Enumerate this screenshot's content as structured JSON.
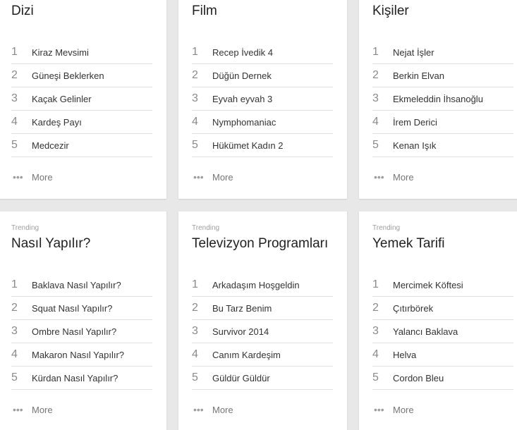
{
  "cards": [
    {
      "label": "",
      "title": "Dizi",
      "items": [
        {
          "rank": "1",
          "name": "Kiraz Mevsimi"
        },
        {
          "rank": "2",
          "name": "Güneşi Beklerken"
        },
        {
          "rank": "3",
          "name": "Kaçak Gelinler"
        },
        {
          "rank": "4",
          "name": "Kardeş Payı"
        },
        {
          "rank": "5",
          "name": "Medcezir"
        }
      ],
      "more": "More"
    },
    {
      "label": "",
      "title": "Film",
      "items": [
        {
          "rank": "1",
          "name": "Recep İvedik 4"
        },
        {
          "rank": "2",
          "name": "Düğün Dernek"
        },
        {
          "rank": "3",
          "name": "Eyvah eyvah 3"
        },
        {
          "rank": "4",
          "name": "Nymphomaniac"
        },
        {
          "rank": "5",
          "name": "Hükümet Kadın 2"
        }
      ],
      "more": "More"
    },
    {
      "label": "",
      "title": "Kişiler",
      "items": [
        {
          "rank": "1",
          "name": "Nejat İşler"
        },
        {
          "rank": "2",
          "name": "Berkin Elvan"
        },
        {
          "rank": "3",
          "name": "Ekmeleddin İhsanoğlu"
        },
        {
          "rank": "4",
          "name": "İrem Derici"
        },
        {
          "rank": "5",
          "name": "Kenan Işık"
        }
      ],
      "more": "More"
    },
    {
      "label": "Trending",
      "title": "Nasıl Yapılır?",
      "items": [
        {
          "rank": "1",
          "name": "Baklava Nasıl Yapılır?"
        },
        {
          "rank": "2",
          "name": "Squat Nasıl Yapılır?"
        },
        {
          "rank": "3",
          "name": "Ombre Nasıl Yapılır?"
        },
        {
          "rank": "4",
          "name": "Makaron Nasıl Yapılır?"
        },
        {
          "rank": "5",
          "name": "Kürdan Nasıl Yapılır?"
        }
      ],
      "more": "More"
    },
    {
      "label": "Trending",
      "title": "Televizyon Programları",
      "items": [
        {
          "rank": "1",
          "name": "Arkadaşım Hoşgeldin"
        },
        {
          "rank": "2",
          "name": "Bu Tarz Benim"
        },
        {
          "rank": "3",
          "name": "Survivor 2014"
        },
        {
          "rank": "4",
          "name": "Canım Kardeşim"
        },
        {
          "rank": "5",
          "name": "Güldür Güldür"
        }
      ],
      "more": "More"
    },
    {
      "label": "Trending",
      "title": "Yemek Tarifi",
      "items": [
        {
          "rank": "1",
          "name": "Mercimek Köftesi"
        },
        {
          "rank": "2",
          "name": "Çıtırbörek"
        },
        {
          "rank": "3",
          "name": "Yalancı Baklava"
        },
        {
          "rank": "4",
          "name": "Helva"
        },
        {
          "rank": "5",
          "name": "Cordon Bleu"
        }
      ],
      "more": "More"
    }
  ]
}
